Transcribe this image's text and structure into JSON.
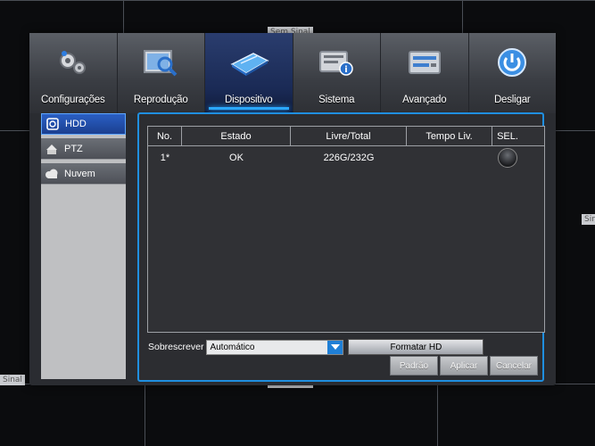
{
  "background": {
    "signal_labels": [
      "Sem Sinal",
      "Sinal",
      "Sem Sinal",
      "Sinal"
    ]
  },
  "menu": {
    "items": [
      {
        "label": "Configurações",
        "icon": "gears-icon"
      },
      {
        "label": "Reprodução",
        "icon": "playback-search-icon"
      },
      {
        "label": "Dispositivo",
        "icon": "hard-drive-icon",
        "active": true
      },
      {
        "label": "Sistema",
        "icon": "system-info-icon"
      },
      {
        "label": "Avançado",
        "icon": "advanced-settings-icon"
      },
      {
        "label": "Desligar",
        "icon": "power-icon"
      }
    ]
  },
  "sidenav": {
    "items": [
      {
        "label": "HDD",
        "icon": "hdd-icon",
        "active": true
      },
      {
        "label": "PTZ",
        "icon": "ptz-camera-icon"
      },
      {
        "label": "Nuvem",
        "icon": "cloud-icon"
      }
    ]
  },
  "table": {
    "headers": [
      "No.",
      "Estado",
      "Livre/Total",
      "Tempo Liv.",
      "SEL."
    ],
    "rows": [
      {
        "no": "1*",
        "estado": "OK",
        "livre_total": "226G/232G",
        "tempo_liv": ""
      }
    ]
  },
  "overwrite": {
    "label": "Sobrescrever",
    "value": "Automático"
  },
  "format_button": "Formatar HD",
  "footer": {
    "default": "Padrão",
    "apply": "Aplicar",
    "cancel": "Cancelar"
  },
  "colors": {
    "accent": "#1f8fe0",
    "active_menu": "#1a2a55",
    "active_nav": "#2a5fc4"
  }
}
